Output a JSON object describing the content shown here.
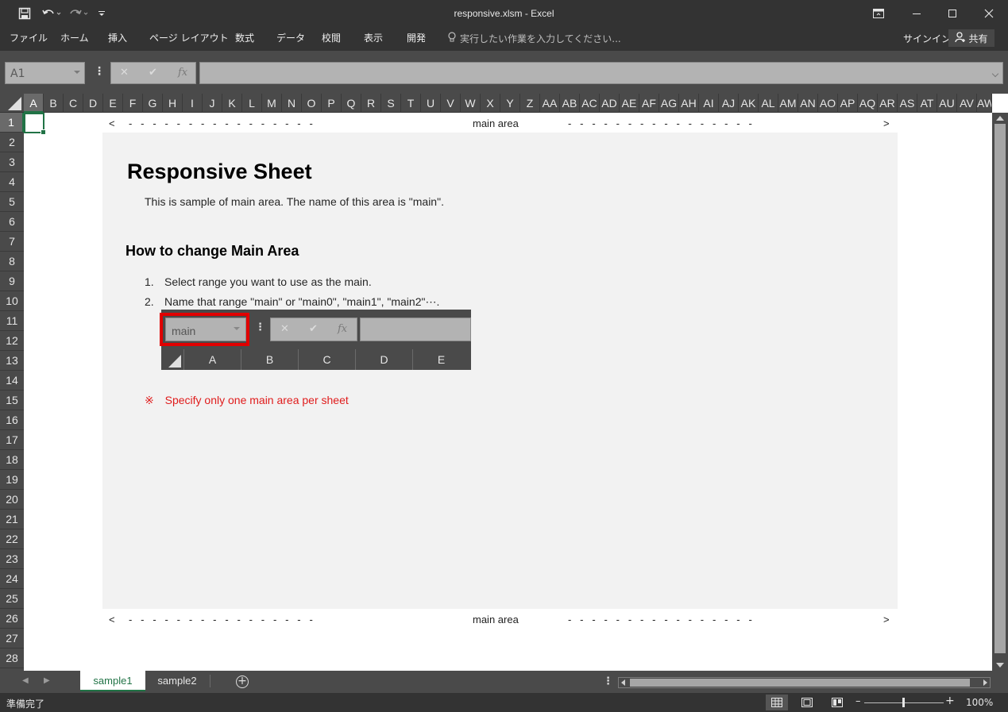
{
  "window": {
    "title": "responsive.xlsm - Excel"
  },
  "ribbon": {
    "tabs": [
      "ファイル",
      "ホーム",
      "挿入",
      "ページ レイアウト",
      "数式",
      "データ",
      "校閲",
      "表示",
      "開発"
    ],
    "tell_me": "実行したい作業を入力してください...",
    "sign_in": "サインイン",
    "share": "共有"
  },
  "formula_bar": {
    "name_box": "A1",
    "fx_label": "fx",
    "value": ""
  },
  "grid": {
    "columns": [
      "A",
      "B",
      "C",
      "D",
      "E",
      "F",
      "G",
      "H",
      "I",
      "J",
      "K",
      "L",
      "M",
      "N",
      "O",
      "P",
      "Q",
      "R",
      "S",
      "T",
      "U",
      "V",
      "W",
      "X",
      "Y",
      "Z",
      "AA",
      "AB",
      "AC",
      "AD",
      "AE",
      "AF",
      "AG",
      "AH",
      "AI",
      "AJ",
      "AK",
      "AL",
      "AM",
      "AN",
      "AO",
      "AP",
      "AQ",
      "AR",
      "AS",
      "AT",
      "AU",
      "AV",
      "AW"
    ],
    "rows": [
      "1",
      "2",
      "3",
      "4",
      "5",
      "6",
      "7",
      "8",
      "9",
      "10",
      "11",
      "12",
      "13",
      "14",
      "15",
      "16",
      "17",
      "18",
      "19",
      "20",
      "21",
      "22",
      "23",
      "24",
      "25",
      "26",
      "27",
      "28"
    ],
    "selected_cell": "A1"
  },
  "sheet": {
    "top_marker": {
      "left": "<",
      "label": "main area",
      "right": ">"
    },
    "bottom_marker": {
      "left": "<",
      "label": "main area",
      "right": ">"
    },
    "title": "Responsive Sheet",
    "description": "This is sample of main area. The name of this area is \"main\".",
    "subtitle": "How to change Main Area",
    "steps": [
      {
        "num": "1.",
        "text": "Select range you want to use as the main."
      },
      {
        "num": "2.",
        "text": "Name that range \"main\" or \"main0\", \"main1\", \"main2\"⋯."
      }
    ],
    "illustration": {
      "name_box": "main",
      "columns": [
        "A",
        "B",
        "C",
        "D",
        "E"
      ]
    },
    "note": {
      "mark": "※",
      "text": "Specify only one main area per sheet"
    },
    "accent_color": "#e01c1c"
  },
  "sheet_tabs": [
    "sample1",
    "sample2"
  ],
  "active_sheet": "sample1",
  "status": {
    "ready": "準備完了",
    "zoom": "100%"
  },
  "colors": {
    "excel_green": "#217346",
    "highlight_red": "#e00000"
  }
}
